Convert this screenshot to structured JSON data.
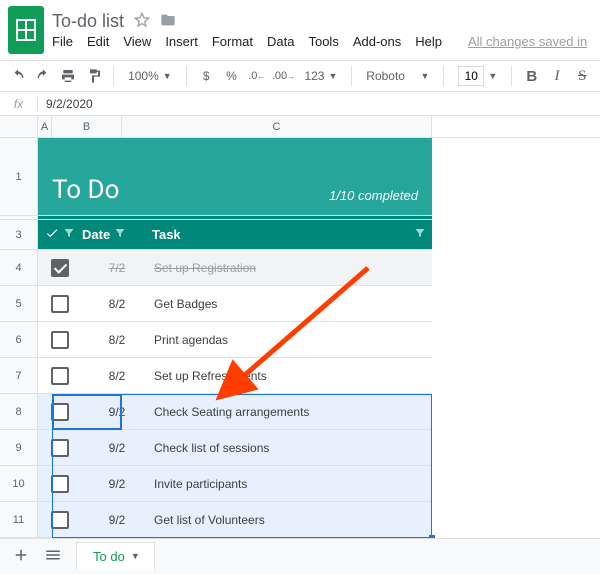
{
  "doc": {
    "title": "To-do list",
    "saved_msg": "All changes saved in"
  },
  "menus": [
    "File",
    "Edit",
    "View",
    "Insert",
    "Format",
    "Data",
    "Tools",
    "Add-ons",
    "Help"
  ],
  "toolbar": {
    "zoom": "100%",
    "currency": "$",
    "percent": "%",
    "dec_dec": ".0",
    "inc_dec": ".00",
    "numfmt": "123",
    "font": "Roboto",
    "fontsize": "10",
    "bold": "B",
    "italic": "I",
    "strike": "S"
  },
  "formula": {
    "label": "fx",
    "value": "9/2/2020"
  },
  "columns": {
    "A": "A",
    "B": "B",
    "C": "C"
  },
  "banner": {
    "title": "To Do",
    "progress": "1/10 completed"
  },
  "header": {
    "date": "Date",
    "task": "Task"
  },
  "rows": [
    {
      "n": "4",
      "date": "7/2",
      "task": "Set up Registration",
      "done": true,
      "sel": false
    },
    {
      "n": "5",
      "date": "8/2",
      "task": "Get Badges",
      "done": false,
      "sel": false
    },
    {
      "n": "6",
      "date": "8/2",
      "task": "Print agendas",
      "done": false,
      "sel": false
    },
    {
      "n": "7",
      "date": "8/2",
      "task": "Set up Refreshments",
      "done": false,
      "sel": false
    },
    {
      "n": "8",
      "date": "9/2",
      "task": "Check Seating arrangements",
      "done": false,
      "sel": true
    },
    {
      "n": "9",
      "date": "9/2",
      "task": "Check list of sessions",
      "done": false,
      "sel": true
    },
    {
      "n": "10",
      "date": "9/2",
      "task": "Invite participants",
      "done": false,
      "sel": true
    },
    {
      "n": "11",
      "date": "9/2",
      "task": "Get list of Volunteers",
      "done": false,
      "sel": true
    }
  ],
  "rowlabels": {
    "r1": "1",
    "r3": "3"
  },
  "tab": {
    "name": "To do"
  }
}
